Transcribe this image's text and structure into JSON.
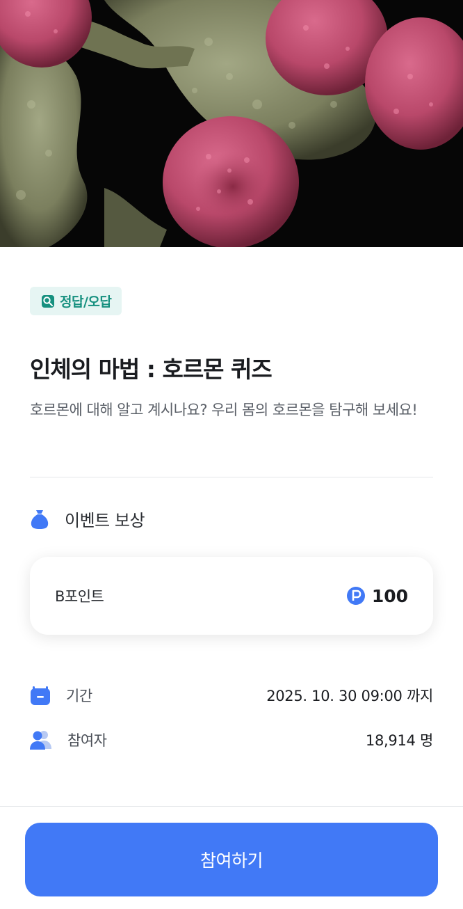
{
  "hero": {
    "image": "microscope-cells-image"
  },
  "tag": {
    "icon": "quiz-icon",
    "label": "정답/오답",
    "color": "#16907f"
  },
  "title": "인체의 마법 : 호르몬 퀴즈",
  "description": "호르몬에 대해 알고 계시나요? 우리 몸의 호르몬을 탐구해 보세요!",
  "reward": {
    "icon": "money-bag-icon",
    "heading": "이벤트 보상",
    "item_name": "B포인트",
    "point_icon": "point-coin-icon",
    "value": "100"
  },
  "period": {
    "icon": "calendar-icon",
    "label": "기간",
    "value": "2025. 10. 30 09:00 까지"
  },
  "participants": {
    "icon": "people-icon",
    "label": "참여자",
    "value": "18,914 명"
  },
  "cta": {
    "label": "참여하기",
    "color": "#4179f6"
  }
}
